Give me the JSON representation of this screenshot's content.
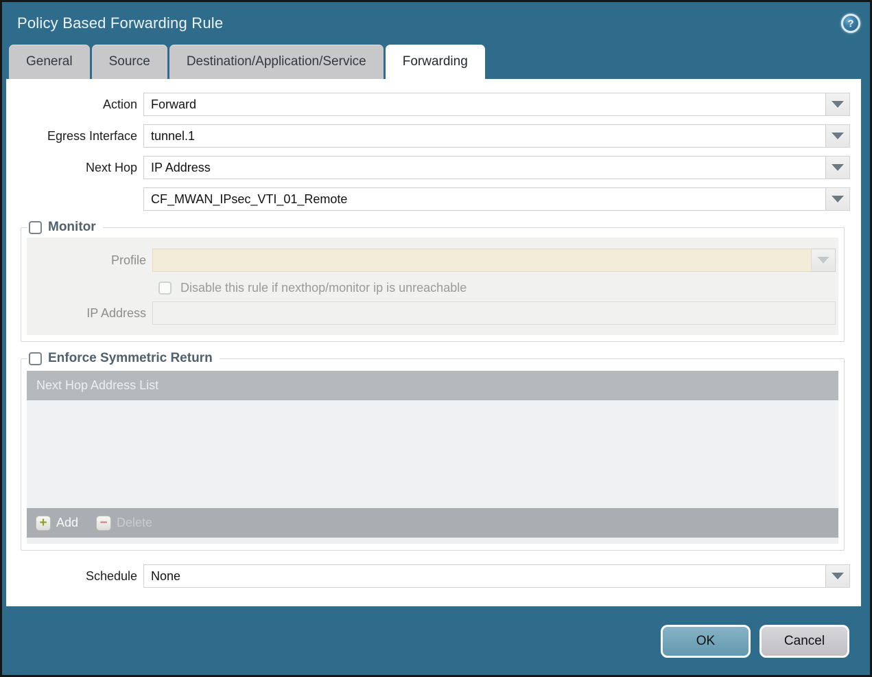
{
  "window": {
    "title": "Policy Based Forwarding Rule",
    "help_icon_glyph": "?"
  },
  "tabs": {
    "items": [
      {
        "label": "General",
        "active": false
      },
      {
        "label": "Source",
        "active": false
      },
      {
        "label": "Destination/Application/Service",
        "active": false
      },
      {
        "label": "Forwarding",
        "active": true
      }
    ]
  },
  "form": {
    "action_label": "Action",
    "action_value": "Forward",
    "egress_label": "Egress Interface",
    "egress_value": "tunnel.1",
    "next_hop_label": "Next Hop",
    "next_hop_value": "IP Address",
    "next_hop_address_value": "CF_MWAN_IPsec_VTI_01_Remote",
    "schedule_label": "Schedule",
    "schedule_value": "None"
  },
  "monitor": {
    "legend": "Monitor",
    "checked": false,
    "profile_label": "Profile",
    "profile_value": "",
    "disable_checkbox_label": "Disable this rule if nexthop/monitor ip is unreachable",
    "disable_checkbox_checked": false,
    "ip_address_label": "IP Address",
    "ip_address_value": ""
  },
  "enforce_symmetric_return": {
    "legend": "Enforce Symmetric Return",
    "checked": false,
    "table": {
      "header": "Next Hop Address List",
      "rows": []
    },
    "add_label": "Add",
    "delete_label": "Delete",
    "delete_enabled": false
  },
  "footer": {
    "ok_label": "OK",
    "cancel_label": "Cancel"
  },
  "colors": {
    "titlebar": "#2F6C8C",
    "tab_inactive": "#C8C8CA",
    "tab_active": "#FFFFFF",
    "disabled_profile_field": "#F3ECD9",
    "table_header": "#B5B9BC",
    "ok_button": "#74A7BB",
    "cancel_button": "#CACACD",
    "add_icon": "#8FA030",
    "delete_icon": "#C97F85"
  }
}
